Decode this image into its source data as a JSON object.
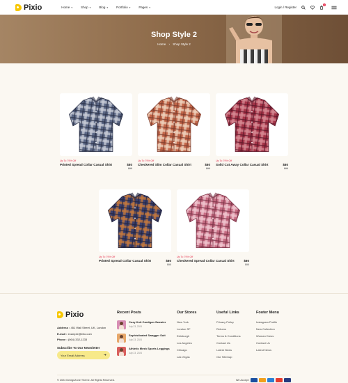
{
  "header": {
    "logo": "Pixio",
    "nav": [
      {
        "label": "Home"
      },
      {
        "label": "Shop"
      },
      {
        "label": "Blog"
      },
      {
        "label": "Portfolio"
      },
      {
        "label": "Pages"
      }
    ],
    "login": "Login / Register",
    "cart_count": "1"
  },
  "banner": {
    "title": "Shop Style 2",
    "crumb_home": "Home",
    "crumb_current": "Shop Style 2"
  },
  "products": [
    {
      "discount": "Up To 79% Off",
      "name": "Printed Spread Collar Casual Shirt",
      "price": "$80",
      "old_price": "$95",
      "colors": [
        "#5b6785",
        "#c9cdd8",
        "#2b3147"
      ]
    },
    {
      "discount": "Up To 79% Off",
      "name": "Checkered Slim Collar Casual Shirt",
      "price": "$80",
      "old_price": "$95",
      "colors": [
        "#c4674a",
        "#efd2bd",
        "#7a3b2c"
      ]
    },
    {
      "discount": "Up To 79% Off",
      "name": "Solid Cut Away Collar Casual Shirt",
      "price": "$80",
      "old_price": "$95",
      "colors": [
        "#a53448",
        "#d68a94",
        "#5a1628"
      ]
    },
    {
      "discount": "Up To 79% Off",
      "name": "Printed Spread Collar Casual Shirt",
      "price": "$80",
      "old_price": "$95",
      "colors": [
        "#3a3f6d",
        "#c8793a",
        "#23243f"
      ]
    },
    {
      "discount": "Up To 79% Off",
      "name": "Checkered Spread Collar Casual Shirt",
      "price": "$80",
      "old_price": "$95",
      "colors": [
        "#c66c83",
        "#f0c7d0",
        "#7c3347"
      ]
    }
  ],
  "footer": {
    "logo": "Pixio",
    "address_label": "Address :",
    "address": "451 Wall Street, UK, London",
    "email_label": "E-mail :",
    "email": "example@info.com",
    "phone_label": "Phone :",
    "phone": "(064) 332-1233",
    "newsletter_title": "Subscribe To Our Newsletter",
    "newsletter_placeholder": "Your Email Address",
    "recent_posts_title": "Recent Posts",
    "posts": [
      {
        "title": "Cozy Knit Cardigan Sweater",
        "date": "July 23, 2024"
      },
      {
        "title": "Sophisticated Swagger Suit",
        "date": "July 23, 2024"
      },
      {
        "title": "Athletic Mesh Sports Leggings",
        "date": "July 23, 2024"
      }
    ],
    "stores_title": "Our Stores",
    "stores": [
      "New York",
      "London SF",
      "Edinburgh",
      "Los Angeles",
      "Chicago",
      "Las Vegas"
    ],
    "useful_title": "Useful Links",
    "useful": [
      "Privacy Policy",
      "Returns",
      "Terms & Conditions",
      "Contact Us",
      "Latest News",
      "Our Sitemap"
    ],
    "menu_title": "Footer Menu",
    "menu": [
      "Instagram Profile",
      "New Collection",
      "Woman Dress",
      "Contact Us",
      "Latest News"
    ],
    "copyright": "© 2024 DexignZone Theme. All Rights Reserved.",
    "we_accept": "We Accept:"
  }
}
